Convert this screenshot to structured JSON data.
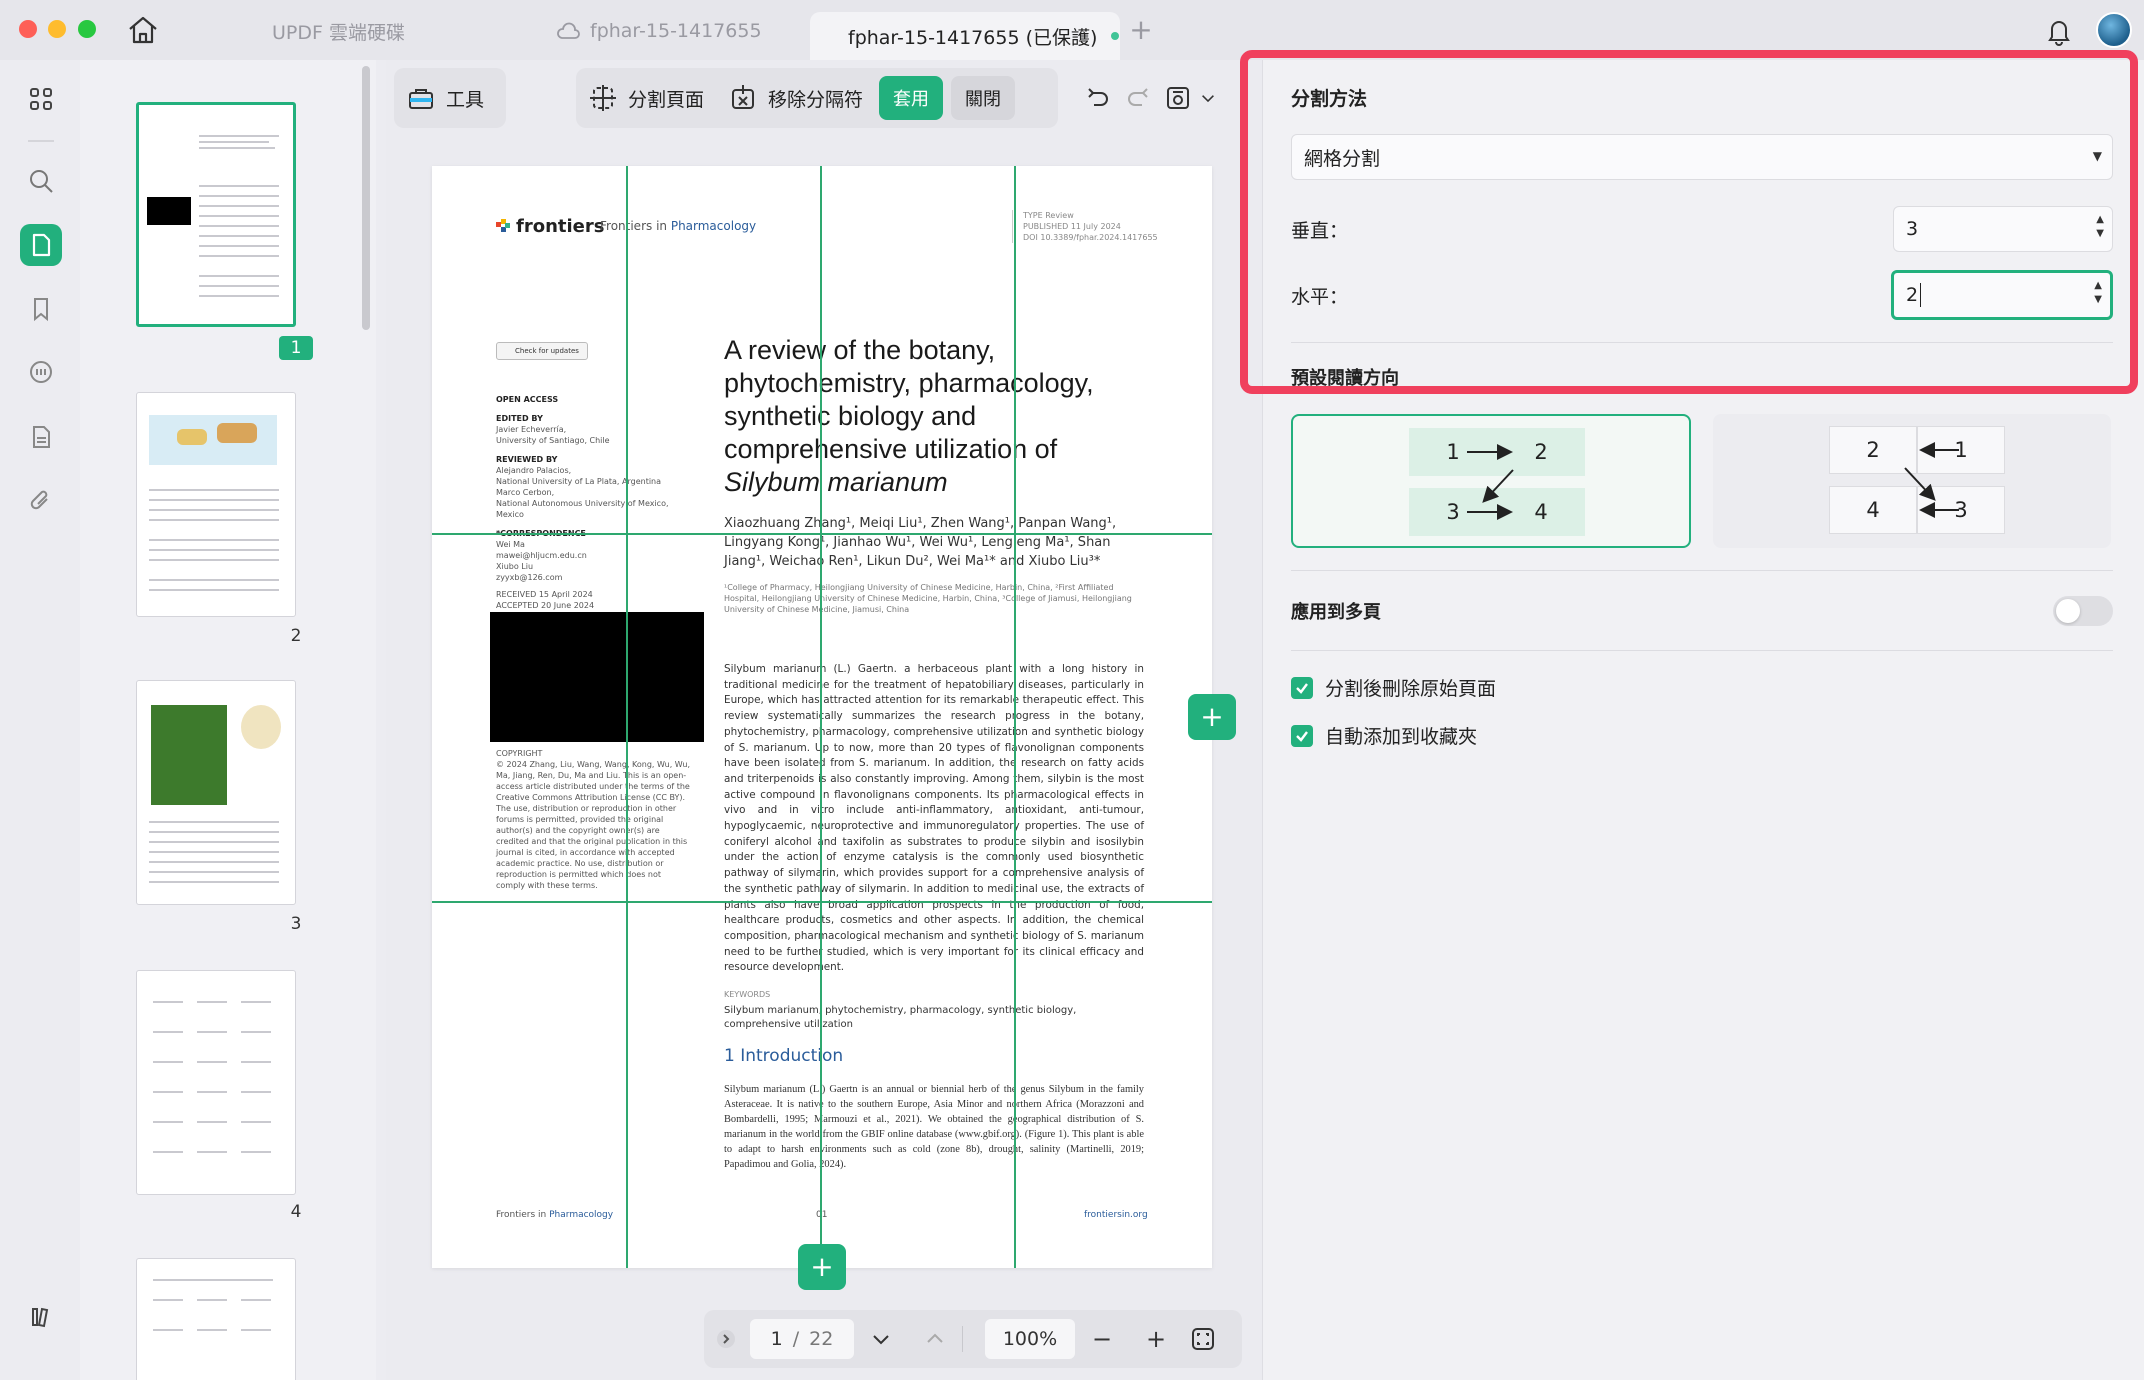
{
  "window": {
    "tabs": [
      {
        "label": "UPDF 雲端硬碟"
      },
      {
        "label": "fphar-15-1417655"
      },
      {
        "label": "fphar-15-1417655 (已保護)"
      }
    ],
    "new_tab": "+"
  },
  "thumbnails": {
    "items": [
      {
        "label": "1"
      },
      {
        "label": "2"
      },
      {
        "label": "3"
      },
      {
        "label": "4"
      }
    ]
  },
  "toolbar": {
    "tools_label": "工具",
    "split_page_label": "分割頁面",
    "remove_separator_label": "移除分隔符",
    "apply_label": "套用",
    "close_label": "關閉"
  },
  "document": {
    "logo": "frontiers",
    "journal_prefix": "Frontiers in ",
    "journal_name": "Pharmacology",
    "meta_top": [
      "TYPE Review",
      "PUBLISHED 11 July 2024",
      "DOI 10.3389/fphar.2024.1417655"
    ],
    "check_updates": "Check for updates",
    "side": {
      "open_access": "OPEN ACCESS",
      "edited_by_h": "EDITED BY",
      "edited_by": "Javier Echeverría,\nUniversity of Santiago, Chile",
      "reviewed_by_h": "REVIEWED BY",
      "reviewed_by": "Alejandro Palacios,\nNational University of La Plata, Argentina\nMarco Cerbon,\nNational Autonomous University of Mexico,\nMexico",
      "correspondence_h": "*CORRESPONDENCE",
      "correspondence": "Wei Ma\nmawei@hljucm.edu.cn\nXiubo Liu\nzyyxb@126.com",
      "received": "RECEIVED 15 April 2024",
      "accepted": "ACCEPTED 20 June 2024",
      "copyright_h": "COPYRIGHT",
      "copyright": "© 2024 Zhang, Liu, Wang, Wang, Kong, Wu, Wu, Ma, Jiang, Ren, Du, Ma and Liu. This is an open-access article distributed under the terms of the Creative Commons Attribution License (CC BY). The use, distribution or reproduction in other forums is permitted, provided the original author(s) and the copyright owner(s) are credited and that the original publication in this journal is cited, in accordance with accepted academic practice. No use, distribution or reproduction is permitted which does not comply with these terms."
    },
    "title_plain": "A review of the botany, phytochemistry, pharmacology, synthetic biology and comprehensive utilization of",
    "title_italic": "Silybum marianum",
    "authors": "Xiaozhuang Zhang¹, Meiqi Liu¹, Zhen Wang¹, Panpan Wang¹, Lingyang Kong¹, Jianhao Wu¹, Wei Wu¹, Lengleng Ma¹, Shan Jiang¹, Weichao Ren¹, Likun Du², Wei Ma¹* and Xiubo Liu³*",
    "affiliations": "¹College of Pharmacy, Heilongjiang University of Chinese Medicine, Harbin, China, ²First Affiliated Hospital, Heilongjiang University of Chinese Medicine, Harbin, China, ³College of Jiamusi, Heilongjiang University of Chinese Medicine, Jiamusi, China",
    "abstract": "Silybum marianum (L.) Gaertn. a herbaceous plant with a long history in traditional medicine for the treatment of hepatobiliary diseases, particularly in Europe, which has attracted attention for its remarkable therapeutic effect. This review systematically summarizes the research progress in the botany, phytochemistry, pharmacology, comprehensive utilization and synthetic biology of S. marianum. Up to now, more than 20 types of flavonolignan components have been isolated from S. marianum. In addition, the research on fatty acids and triterpenoids is also constantly improving. Among them, silybin is the most active compound in flavonolignans components. Its pharmacological effects in vivo and in vitro include anti-inflammatory, antioxidant, anti-tumour, hypoglycaemic, neuroprotective and immunoregulatory properties. The use of coniferyl alcohol and taxifolin as substrates to produce silybin and isosilybin under the action of enzyme catalysis is the commonly used biosynthetic pathway of silymarin, which provides support for a comprehensive analysis of the synthetic pathway of silymarin. In addition to medicinal use, the extracts of plants also have broad application prospects in the production of food, healthcare products, cosmetics and other aspects. In addition, the chemical composition, pharmacological mechanism and synthetic biology of S. marianum need to be further studied, which is very important for its clinical efficacy and resource development.",
    "keywords_h": "KEYWORDS",
    "keywords": "Silybum marianum, phytochemistry, pharmacology, synthetic biology, comprehensive utilization",
    "intro_h": "1 Introduction",
    "intro": "Silybum marianum (L.) Gaertn is an annual or biennial herb of the genus Silybum in the family Asteraceae. It is native to the southern Europe, Asia Minor and northern Africa (Morazzoni and Bombardelli, 1995; Marmouzi et al., 2021). We obtained the geographical distribution of S. marianum in the world from the GBIF online database (www.gbif.org). (Figure 1). This plant is able to adapt to harsh environments such as cold (zone 8b), drought, salinity (Martinelli, 2019; Papadimou and Golia, 2024).",
    "footer_left_prefix": "Frontiers in ",
    "footer_left_name": "Pharmacology",
    "footer_center": "01",
    "footer_right": "frontiersin.org"
  },
  "nav": {
    "current_page": "1",
    "separator": "/",
    "total_pages": "22",
    "zoom": "100%",
    "zoom_out": "−",
    "zoom_in": "+"
  },
  "panel": {
    "split_method_h": "分割方法",
    "split_method_value": "網格分割",
    "vertical_label": "垂直：",
    "vertical_value": "3",
    "horizontal_label": "水平：",
    "horizontal_value": "2",
    "reading_order_h": "預設閱讀方向",
    "order_ltr": [
      "1",
      "2",
      "3",
      "4"
    ],
    "order_rtl": [
      "2",
      "1",
      "4",
      "3"
    ],
    "apply_multiple_label": "應用到多頁",
    "apply_multiple_on": false,
    "delete_original_label": "分割後刪除原始頁面",
    "delete_original_checked": true,
    "add_bookmark_label": "自動添加到收藏夾",
    "add_bookmark_checked": true
  },
  "colors": {
    "accent": "#22b07d",
    "highlight": "#f0405d"
  }
}
